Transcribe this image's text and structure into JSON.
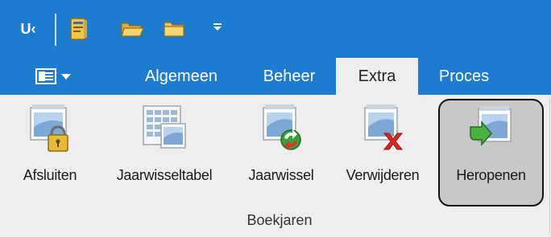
{
  "quick_access": {
    "logo_text": "U‹",
    "items": [
      "book-icon",
      "open-folder-icon",
      "folder-icon"
    ],
    "dropdown_icon": "customize-dropdown-icon"
  },
  "tabs": [
    {
      "label": "Algemeen",
      "active": false
    },
    {
      "label": "Beheer",
      "active": false
    },
    {
      "label": "Extra",
      "active": true
    },
    {
      "label": "Proces",
      "active": false
    }
  ],
  "ribbon": {
    "buttons": [
      {
        "label": "Afsluiten",
        "icon": "calendar-lock-icon"
      },
      {
        "label": "Jaarwisseltabel",
        "icon": "calendar-table-icon"
      },
      {
        "label": "Jaarwissel",
        "icon": "calendar-refresh-icon"
      },
      {
        "label": "Verwijderen",
        "icon": "calendar-delete-icon"
      },
      {
        "label": "Heropenen",
        "icon": "calendar-reopen-icon",
        "highlighted": true
      }
    ],
    "group_label": "Boekjaren"
  },
  "colors": {
    "titlebar": "#1e7cd0",
    "ribbon_bg": "#eeeeee",
    "highlight": "#c8c8c8"
  }
}
